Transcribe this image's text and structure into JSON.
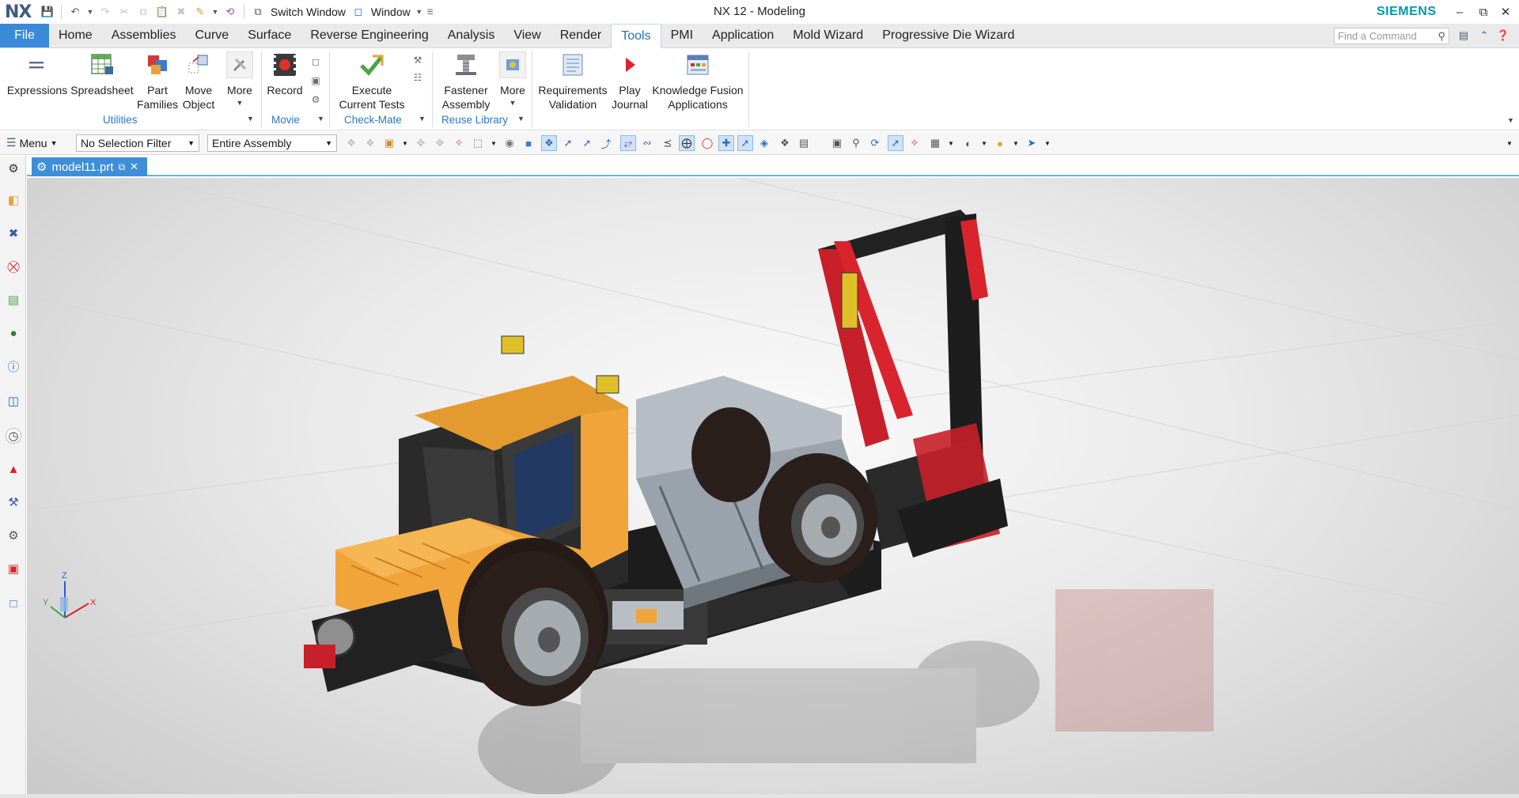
{
  "app": {
    "logo": "NX",
    "window_title": "NX 12 - Modeling",
    "brand": "SIEMENS"
  },
  "quick_access": {
    "switch_window": "Switch Window",
    "window_menu": "Window"
  },
  "tabs": {
    "file": "File",
    "items": [
      "Home",
      "Assemblies",
      "Curve",
      "Surface",
      "Reverse Engineering",
      "Analysis",
      "View",
      "Render",
      "Tools",
      "PMI",
      "Application",
      "Mold Wizard",
      "Progressive Die Wizard"
    ],
    "active": "Tools"
  },
  "find_command": {
    "placeholder": "Find a Command"
  },
  "ribbon": {
    "expressions": "Expressions",
    "spreadsheet": "Spreadsheet",
    "part_families_1": "Part",
    "part_families_2": "Families",
    "move_object_1": "Move",
    "move_object_2": "Object",
    "more": "More",
    "record": "Record",
    "execute_1": "Execute",
    "execute_2": "Current Tests",
    "fastener_1": "Fastener",
    "fastener_2": "Assembly",
    "more2": "More",
    "requirements_1": "Requirements",
    "requirements_2": "Validation",
    "play_1": "Play",
    "play_2": "Journal",
    "kf_1": "Knowledge Fusion",
    "kf_2": "Applications",
    "groups": {
      "utilities": "Utilities",
      "movie": "Movie",
      "checkmate": "Check-Mate",
      "reuse": "Reuse Library"
    }
  },
  "selection_bar": {
    "menu": "Menu",
    "filter": "No Selection Filter",
    "scope": "Entire Assembly"
  },
  "document": {
    "tab": "model11.prt"
  },
  "triad": {
    "x": "X",
    "y": "Y",
    "z": "Z"
  },
  "colors": {
    "file_tab": "#3b8ad9",
    "active_tab_text": "#1e6fc5",
    "group_title": "#2a77c9",
    "brand": "#0099a8",
    "truck_cab": "#f0a43a",
    "truck_frame": "#1d1d1d",
    "truck_crane": "#d9242e",
    "truck_bed": "#9aa3ab"
  }
}
